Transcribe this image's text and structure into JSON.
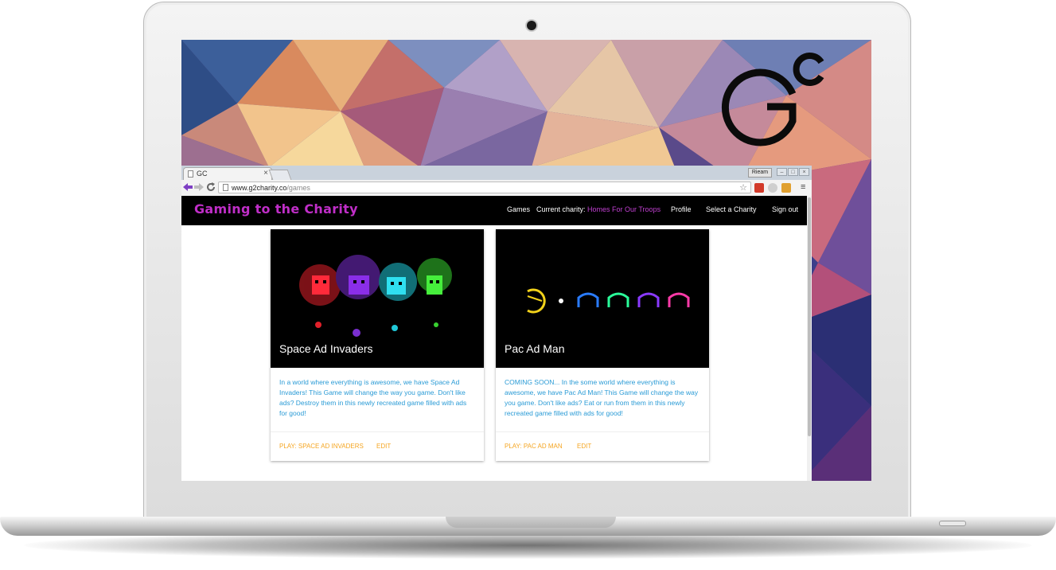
{
  "browser": {
    "tab_title": "GC",
    "tab_close": "×",
    "user_button": "Rieam",
    "url_host": "www.g2charity.co",
    "url_path": "/games",
    "star": "☆",
    "menu": "≡",
    "back_icon": "back-arrow-icon",
    "forward_icon": "forward-arrow-icon",
    "reload_icon": "reload-icon"
  },
  "brand": {
    "logo_text": "Gc"
  },
  "site": {
    "title": "Gaming to the Charity",
    "nav": {
      "games": "Games",
      "current_charity_label": "Current charity:",
      "current_charity_name": "Homes For Our Troops",
      "profile": "Profile",
      "select_charity": "Select a Charity",
      "sign_out": "Sign out"
    },
    "cards": [
      {
        "title": "Space Ad Invaders",
        "description": "In a world where everything is awesome, we have Space Ad Invaders! This Game will change the way you game. Don't like ads? Destroy them in this newly recreated game filled with ads for good!",
        "play_label": "PLAY: SPACE AD INVADERS",
        "edit_label": "EDIT"
      },
      {
        "title": "Pac Ad Man",
        "description": "COMING SOON... In the some world where everything is awesome, we have Pac Ad Man! This Game will change the way you game. Don't like ads? Eat or run from them in this newly recreated game filled with ads for good!",
        "play_label": "PLAY: PAC AD MAN",
        "edit_label": "EDIT"
      }
    ]
  },
  "colors": {
    "accent": "#c02ec8",
    "link": "#f5a623",
    "text_blue": "#2a9bd6",
    "nav_bg": "#000000"
  }
}
